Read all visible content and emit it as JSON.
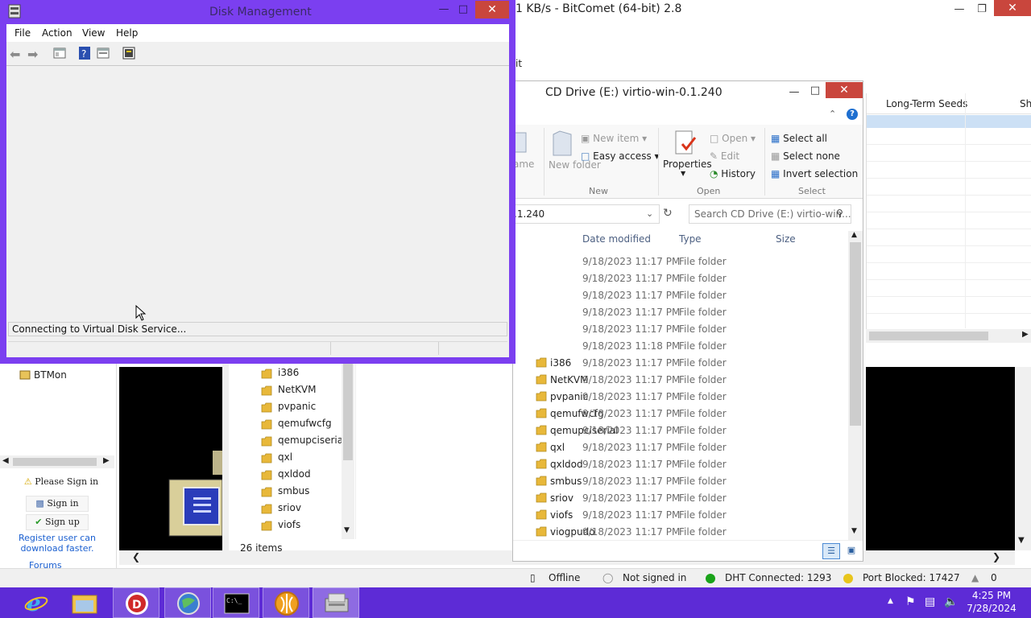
{
  "bitcomet": {
    "title": "1 KB/s - BitComet (64-bit) 2.8",
    "column_long_term_seeds": "Long-Term Seeds",
    "column_sh": "Sh",
    "left_panel": {
      "btmon": "BTMon",
      "please_sign_in": "Please Sign in",
      "sign_in": "Sign in",
      "sign_up": "Sign up",
      "register_text": "Register user can download faster.",
      "forums": "Forums"
    },
    "status": {
      "offline": "Offline",
      "not_signed_in": "Not signed in",
      "dht": "DHT Connected: 1293",
      "port_blocked": "Port Blocked: 17427",
      "count": "0"
    },
    "partial_text": "it"
  },
  "explorer": {
    "title": "CD Drive (E:) virtio-win-0.1.240",
    "ribbon": {
      "name_partial": "ame",
      "new_item": "New item",
      "easy_access": "Easy access",
      "new_folder": "New folder",
      "properties": "Properties",
      "open": "Open",
      "edit": "Edit",
      "history": "History",
      "select_all": "Select all",
      "select_none": "Select none",
      "invert_selection": "Invert selection",
      "group_new": "New",
      "group_open": "Open",
      "group_select": "Select"
    },
    "address_partial": ".1.240",
    "search_placeholder": "Search CD Drive (E:) virtio-win...",
    "columns": {
      "date": "Date modified",
      "type": "Type",
      "size": "Size"
    },
    "rows": [
      {
        "name": "",
        "date": "9/18/2023 11:17 PM",
        "type": "File folder"
      },
      {
        "name": "",
        "date": "9/18/2023 11:17 PM",
        "type": "File folder"
      },
      {
        "name": "",
        "date": "9/18/2023 11:17 PM",
        "type": "File folder"
      },
      {
        "name": "",
        "date": "9/18/2023 11:17 PM",
        "type": "File folder"
      },
      {
        "name": "",
        "date": "9/18/2023 11:17 PM",
        "type": "File folder"
      },
      {
        "name": "",
        "date": "9/18/2023 11:18 PM",
        "type": "File folder"
      },
      {
        "name": "i386",
        "date": "9/18/2023 11:17 PM",
        "type": "File folder"
      },
      {
        "name": "NetKVM",
        "date": "9/18/2023 11:17 PM",
        "type": "File folder"
      },
      {
        "name": "pvpanic",
        "date": "9/18/2023 11:17 PM",
        "type": "File folder"
      },
      {
        "name": "qemufwcfg",
        "date": "9/18/2023 11:17 PM",
        "type": "File folder"
      },
      {
        "name": "qemupciserial",
        "date": "9/18/2023 11:17 PM",
        "type": "File folder"
      },
      {
        "name": "qxl",
        "date": "9/18/2023 11:17 PM",
        "type": "File folder"
      },
      {
        "name": "qxldod",
        "date": "9/18/2023 11:17 PM",
        "type": "File folder"
      },
      {
        "name": "smbus",
        "date": "9/18/2023 11:17 PM",
        "type": "File folder"
      },
      {
        "name": "sriov",
        "date": "9/18/2023 11:17 PM",
        "type": "File folder"
      },
      {
        "name": "viofs",
        "date": "9/18/2023 11:17 PM",
        "type": "File folder"
      },
      {
        "name": "viogpudo",
        "date": "9/18/2023 11:17 PM",
        "type": "File folder"
      }
    ],
    "nav_items": [
      "i386",
      "NetKVM",
      "pvpanic",
      "qemufwcfg",
      "qemupciserial",
      "qxl",
      "qxldod",
      "smbus",
      "sriov",
      "viofs"
    ],
    "items_count": "26 items"
  },
  "diskmgmt": {
    "title": "Disk Management",
    "menu": {
      "file": "File",
      "action": "Action",
      "view": "View",
      "help": "Help"
    },
    "status": "Connecting to Virtual Disk Service..."
  },
  "taskbar": {
    "time": "4:25 PM",
    "date": "7/28/2024"
  },
  "colors": {
    "accent_purple": "#7b3ff0",
    "taskbar": "#5d2bd6",
    "close_red": "#c9463d"
  }
}
